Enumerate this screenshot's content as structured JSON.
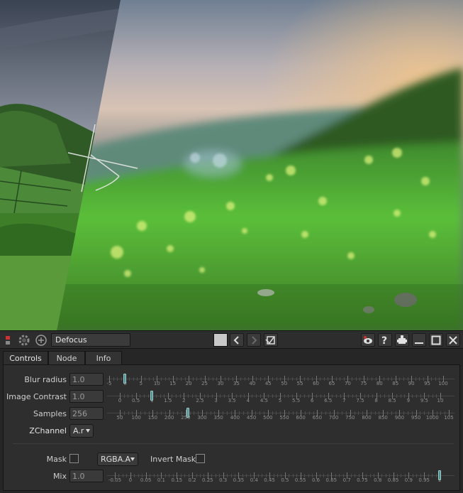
{
  "panel": {
    "node_name": "Defocus",
    "tabs": [
      {
        "label": "Controls"
      },
      {
        "label": "Node"
      },
      {
        "label": "Info"
      }
    ],
    "params": {
      "blur_radius": {
        "label": "Blur radius",
        "value": "1.0",
        "ticks": [
          "-5",
          "0",
          "5",
          "10",
          "15",
          "20",
          "25",
          "30",
          "35",
          "40",
          "45",
          "50",
          "55",
          "60",
          "65",
          "70",
          "75",
          "80",
          "85",
          "90",
          "95",
          "100"
        ],
        "handle_value": 0
      },
      "image_contrast": {
        "label": "Image Contrast",
        "value": "1.0",
        "ticks": [
          "0",
          "0.5",
          "1",
          "1.5",
          "2",
          "2.5",
          "3",
          "3.5",
          "4",
          "4.5",
          "5",
          "5.5",
          "6",
          "6.5",
          "7",
          "7.5",
          "8",
          "8.5",
          "9",
          "9.5",
          "10"
        ],
        "handle_value": 1
      },
      "samples": {
        "label": "Samples",
        "value": "256",
        "ticks": [
          "50",
          "100",
          "150",
          "200",
          "250",
          "300",
          "350",
          "400",
          "450",
          "500",
          "550",
          "600",
          "650",
          "700",
          "750",
          "800",
          "850",
          "900",
          "950",
          "1000",
          "105"
        ],
        "handle_value": 256
      },
      "zchannel": {
        "label": "ZChannel",
        "value": "A.r"
      },
      "mask": {
        "label": "Mask",
        "channel": "RGBA.A",
        "invert_label": "Invert Mask",
        "checked": false,
        "invert_checked": false
      },
      "mix": {
        "label": "Mix",
        "value": "1.0",
        "ticks": [
          "-0.05",
          "0",
          "0.05",
          "0.1",
          "0.15",
          "0.2",
          "0.25",
          "0.3",
          "0.35",
          "0.4",
          "0.45",
          "0.5",
          "0.55",
          "0.6",
          "0.65",
          "0.7",
          "0.75",
          "0.8",
          "0.85",
          "0.9",
          "0.95",
          "1"
        ],
        "handle_value": 1
      }
    }
  },
  "icons": {
    "titlebar_left": [
      "node-color-icon",
      "gear-icon",
      "add-icon"
    ],
    "titlebar_right": [
      "prev-icon",
      "next-icon",
      "restore-icon",
      "viewer-icon",
      "help-icon",
      "float-icon",
      "minimize-icon",
      "maximize-icon",
      "close-icon"
    ]
  },
  "colors": {
    "handle": "#4f8f8f",
    "panel_bg": "#2e2e2e"
  }
}
